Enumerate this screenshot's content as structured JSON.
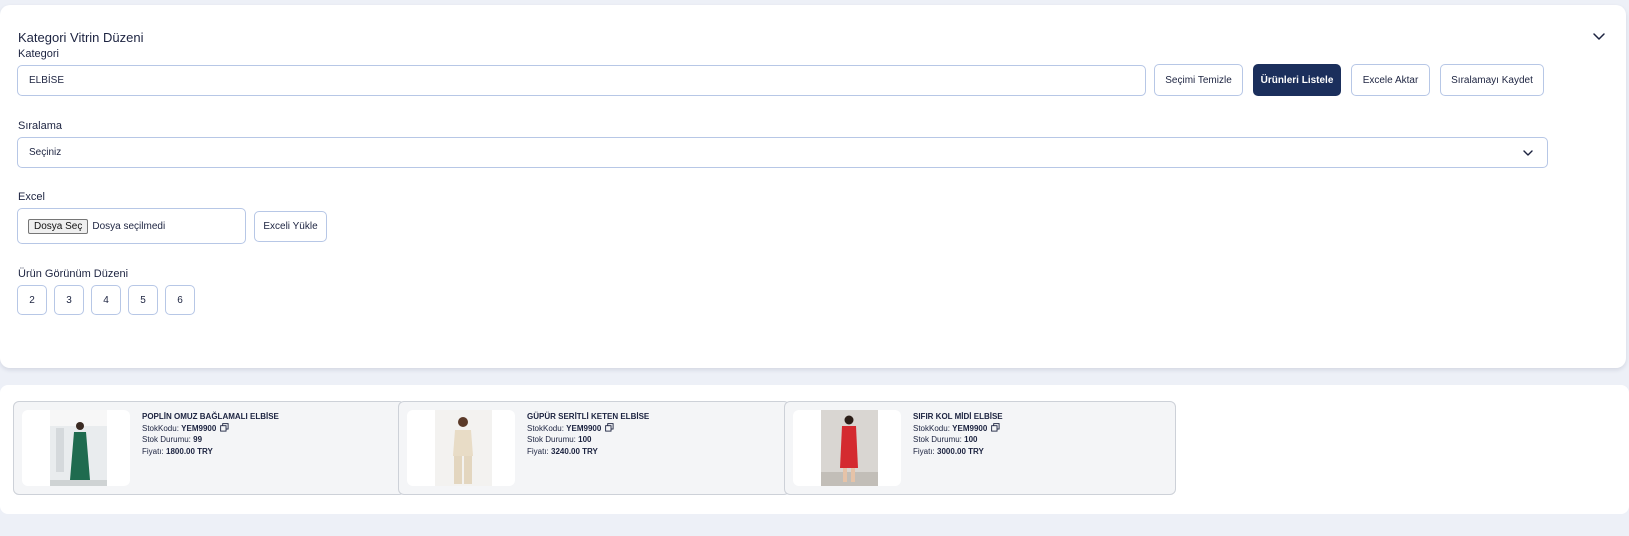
{
  "panel": {
    "title": "Kategori Vitrin Düzeni",
    "category_label": "Kategori",
    "category_value": "ELBİSE",
    "buttons": {
      "clear": "Seçimi Temizle",
      "list": "Ürünleri Listele",
      "export": "Excele Aktar",
      "save_order": "Sıralamayı Kaydet"
    },
    "sort_label": "Sıralama",
    "sort_value": "Seçiniz",
    "excel_label": "Excel",
    "file_button": "Dosya Seç",
    "file_status": "Dosya seçilmedi",
    "upload_button": "Exceli Yükle",
    "layout_label": "Ürün Görünüm Düzeni",
    "layout_options": [
      "2",
      "3",
      "4",
      "5",
      "6"
    ]
  },
  "labels": {
    "stock_code": "StokKodu:",
    "stock_status": "Stok Durumu:",
    "price": "Fiyatı:"
  },
  "products": [
    {
      "name": "POPLİN OMUZ BAĞLAMALI ELBİSE",
      "stock_code": "YEM9900",
      "stock": "99",
      "price": "1800.00 TRY",
      "color": "#1f6b4f"
    },
    {
      "name": "GÜPÜR SERİTLİ KETEN ELBİSE",
      "stock_code": "YEM9900",
      "stock": "100",
      "price": "3240.00 TRY",
      "color": "#e8dcc6"
    },
    {
      "name": "SIFIR KOL MİDİ ELBİSE",
      "stock_code": "YEM9900",
      "stock": "100",
      "price": "3000.00 TRY",
      "color": "#d42a30"
    }
  ],
  "colors": {
    "primary": "#1b2f5c",
    "border": "#b7c7e6",
    "page_bg": "#edf0f7",
    "card_bg": "#f4f5f7"
  }
}
